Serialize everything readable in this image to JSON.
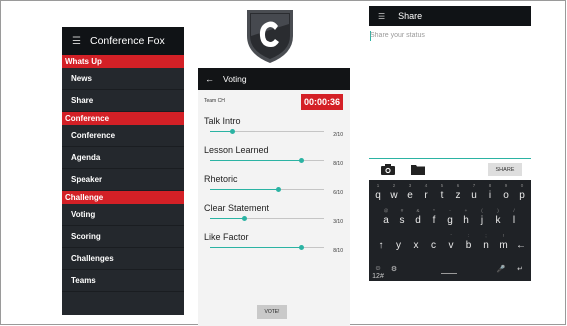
{
  "drawer": {
    "title": "Conference Fox",
    "sections": [
      {
        "label": "Whats Up",
        "items": [
          "News",
          "Share"
        ]
      },
      {
        "label": "Conference",
        "items": [
          "Conference",
          "Agenda",
          "Speaker"
        ]
      },
      {
        "label": "Challenge",
        "items": [
          "Voting",
          "Scoring",
          "Challenges",
          "Teams"
        ]
      }
    ]
  },
  "voting": {
    "title": "Voting",
    "team": "Team CH",
    "timer": "00:00:36",
    "criteria": [
      {
        "label": "Talk Intro",
        "score": "2/10",
        "value": 2
      },
      {
        "label": "Lesson Learned",
        "score": "8/10",
        "value": 8
      },
      {
        "label": "Rhetoric",
        "score": "6/10",
        "value": 6
      },
      {
        "label": "Clear Statement",
        "score": "3/10",
        "value": 3
      },
      {
        "label": "Like Factor",
        "score": "8/10",
        "value": 8
      }
    ],
    "vote_label": "VOTE!"
  },
  "share": {
    "title": "Share",
    "status_placeholder": "Share your status",
    "share_label": "SHARE"
  },
  "keyboard": {
    "row1": [
      [
        "q",
        "1"
      ],
      [
        "w",
        "2"
      ],
      [
        "e",
        "3"
      ],
      [
        "r",
        "4"
      ],
      [
        "t",
        "5"
      ],
      [
        "z",
        "6"
      ],
      [
        "u",
        "7"
      ],
      [
        "i",
        "8"
      ],
      [
        "o",
        "9"
      ],
      [
        "p",
        "0"
      ]
    ],
    "row2": [
      [
        "a",
        "@"
      ],
      [
        "s",
        "#"
      ],
      [
        "d",
        "&"
      ],
      [
        "f",
        "*"
      ],
      [
        "g",
        "-"
      ],
      [
        "h",
        "+"
      ],
      [
        "j",
        "("
      ],
      [
        "k",
        ")"
      ],
      [
        "l",
        "/"
      ]
    ],
    "row3": [
      [
        "↑",
        ""
      ],
      [
        "y",
        ""
      ],
      [
        "x",
        ""
      ],
      [
        "c",
        ""
      ],
      [
        "v",
        "'"
      ],
      [
        "b",
        ":"
      ],
      [
        "n",
        ";"
      ],
      [
        "m",
        "!"
      ],
      [
        "←",
        ""
      ]
    ],
    "row4": [
      [
        "☺",
        ""
      ],
      [
        "⚙",
        ""
      ],
      [
        "12#",
        ""
      ],
      [
        "🎤",
        ""
      ],
      [
        "↵",
        ""
      ]
    ]
  },
  "colors": {
    "accent": "#2bb3a3",
    "red": "#d32026",
    "dark": "#24282d"
  }
}
